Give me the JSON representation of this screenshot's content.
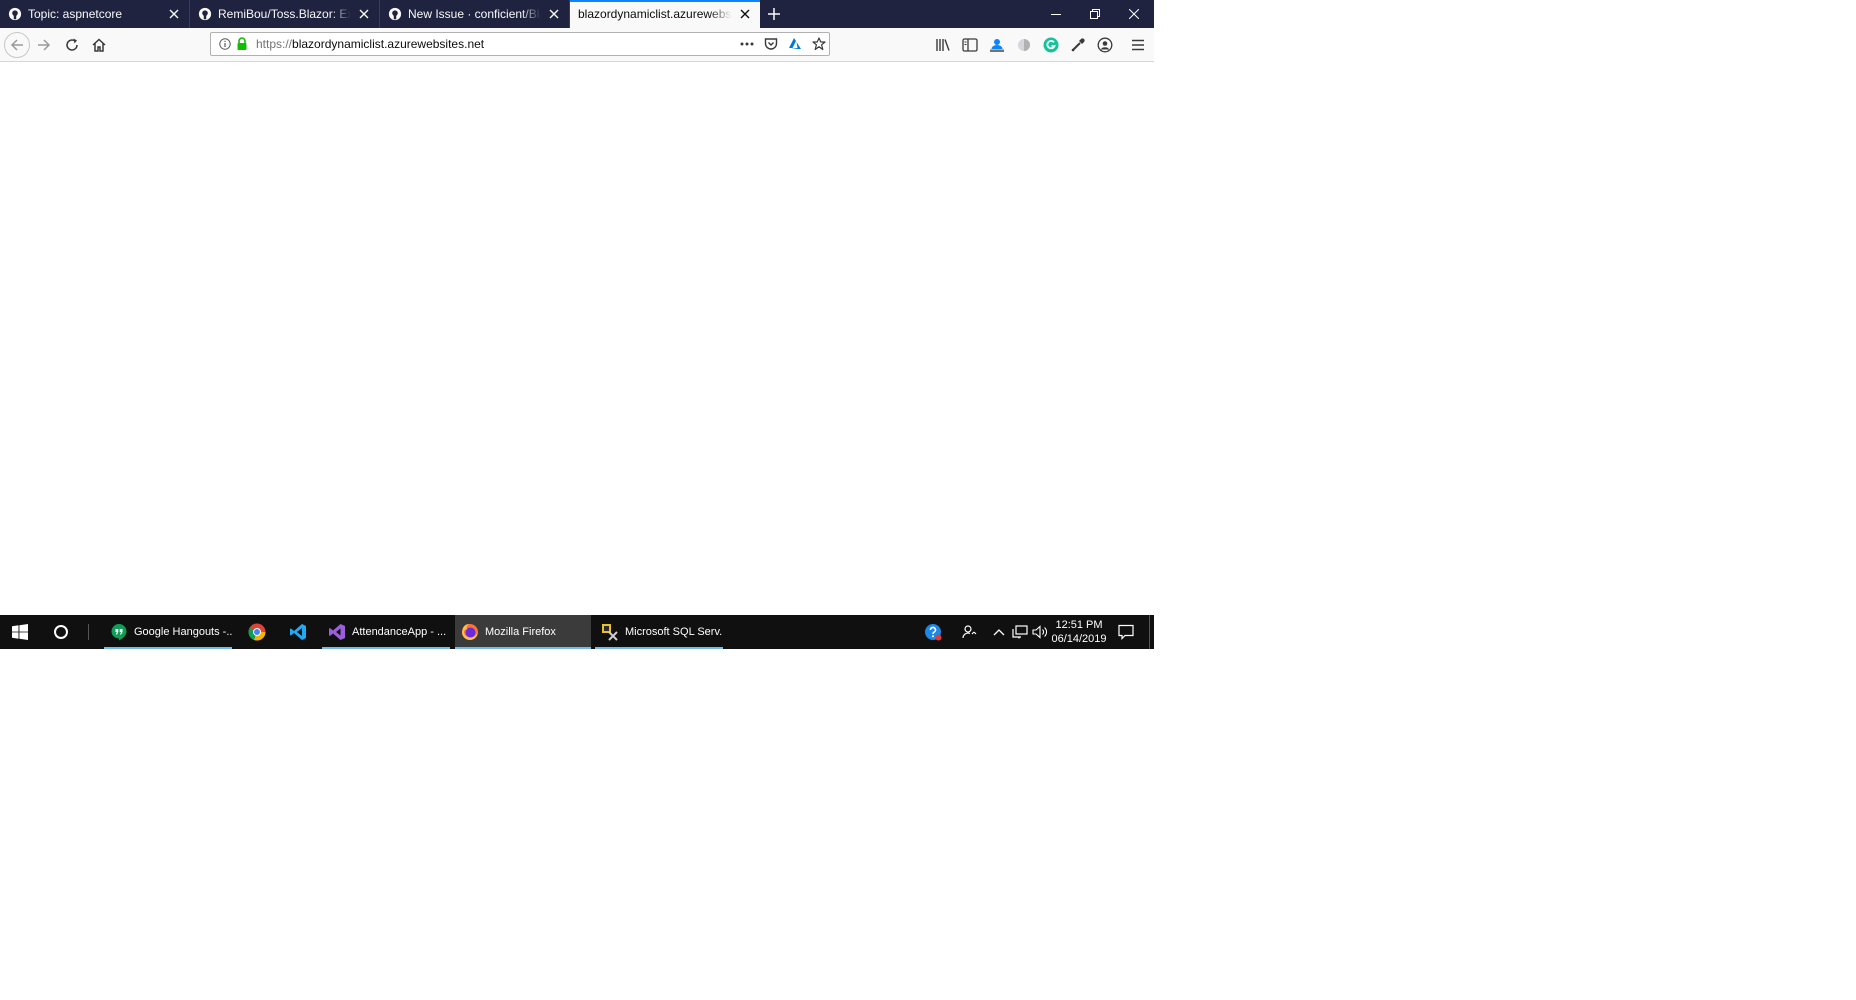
{
  "browser": {
    "tabs": [
      {
        "title": "Topic: aspnetcore",
        "favicon": "github-icon",
        "active": false
      },
      {
        "title": "RemiBou/Toss.Blazor: Experime",
        "favicon": "github-icon",
        "active": false
      },
      {
        "title": "New Issue · conficient/BlazorDy",
        "favicon": "github-icon",
        "active": false
      },
      {
        "title": "blazordynamiclist.azurewebsites.ne",
        "favicon": "none",
        "active": true
      }
    ],
    "url": {
      "scheme": "https://",
      "host": "blazordynamiclist.azurewebsites.net"
    },
    "accent_color": "#0a84ff",
    "tabbar_color": "#202340",
    "secure_color": "#12bc00"
  },
  "taskbar": {
    "items": [
      {
        "label": "Google Hangouts -...",
        "icon": "hangouts-icon",
        "running": true,
        "active": false
      },
      {
        "label": "",
        "icon": "chrome-icon",
        "running": false,
        "active": false
      },
      {
        "label": "",
        "icon": "vscode-icon",
        "running": false,
        "active": false
      },
      {
        "label": "AttendanceApp - ...",
        "icon": "visual-studio-icon",
        "running": true,
        "active": false
      },
      {
        "label": "Mozilla Firefox",
        "icon": "firefox-icon",
        "running": true,
        "active": true
      },
      {
        "label": "Microsoft SQL Serv...",
        "icon": "sql-server-icon",
        "running": true,
        "active": false
      }
    ],
    "clock": {
      "time": "12:51 PM",
      "date": "06/14/2019"
    }
  }
}
